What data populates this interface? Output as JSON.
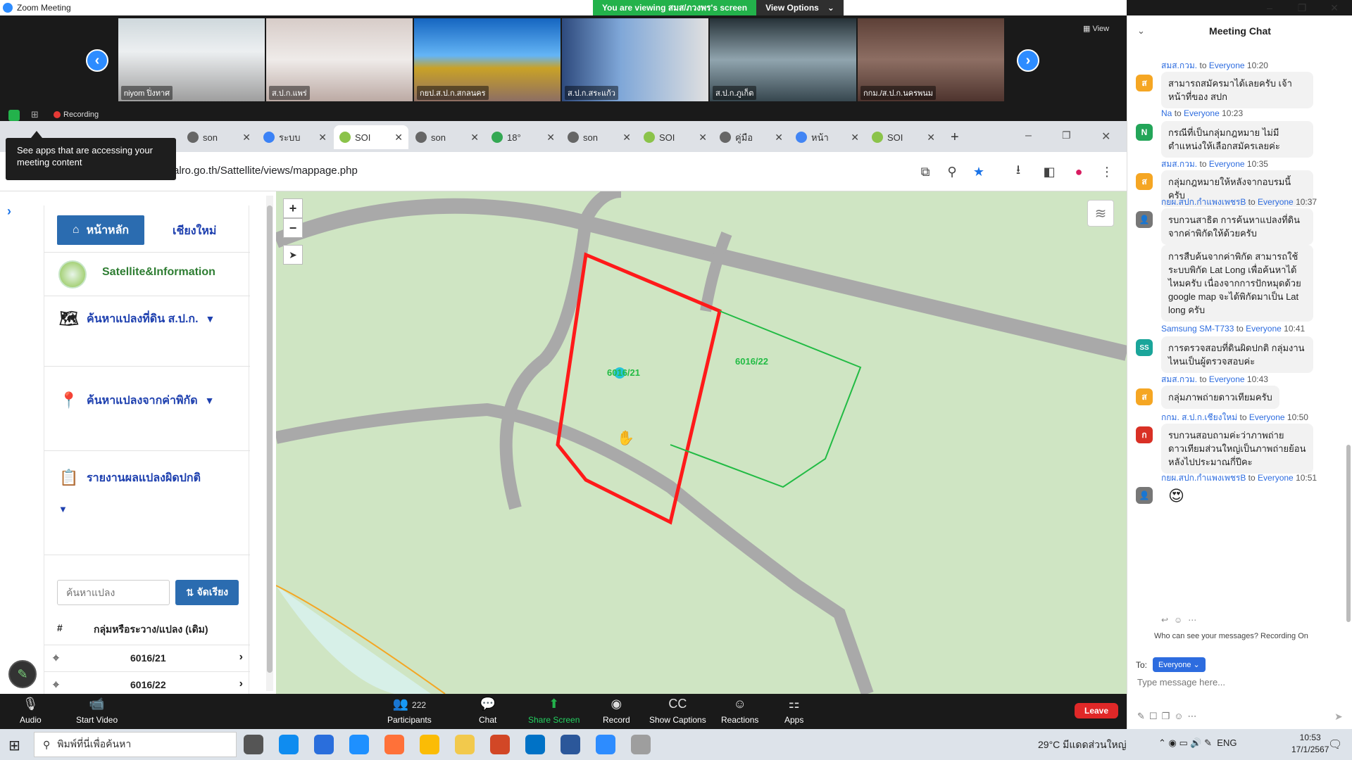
{
  "zoom": {
    "title": "Zoom Meeting",
    "viewing_banner": "You are viewing สมส/ภวงพร's screen",
    "view_options": "View Options",
    "view_label": "View",
    "recording": "Recording",
    "participants": [
      {
        "name": "niyom ปิ่งทาศ"
      },
      {
        "name": "ส.ป.ก.แพร่"
      },
      {
        "name": "กยป.ส.ป.ก.สกลนคร"
      },
      {
        "name": "ส.ป.ก.สระแก้ว"
      },
      {
        "name": "ส.ป.ก.ภูเก็ต"
      },
      {
        "name": "กกม./ส.ป.ก.นครพนม"
      }
    ],
    "toolbar": {
      "audio": "Audio",
      "start_video": "Start Video",
      "participants": "Participants",
      "participant_count": "222",
      "chat": "Chat",
      "share_screen": "Share Screen",
      "record": "Record",
      "show_captions": "Show Captions",
      "reactions": "Reactions",
      "apps": "Apps",
      "leave": "Leave"
    },
    "tooltip": "See apps that are accessing your meeting content"
  },
  "browser": {
    "tabs": [
      {
        "label": "son"
      },
      {
        "label": "SOI"
      },
      {
        "label": "son"
      },
      {
        "label": "ระบบ"
      },
      {
        "label": "SOI"
      },
      {
        "label": "son"
      },
      {
        "label": "18°"
      },
      {
        "label": "son"
      },
      {
        "label": "SOI"
      },
      {
        "label": "คู่มือ"
      },
      {
        "label": "หน้า"
      },
      {
        "label": "SOI"
      }
    ],
    "url": "alro.go.th/Sattellite/views/mappage.php"
  },
  "sidebar": {
    "home": "หน้าหลัก",
    "chiangmai": "เชียงใหม่",
    "brand": "Satellite&Information",
    "menu": [
      {
        "label": "ค้นหาแปลงที่ดิน ส.ป.ก."
      },
      {
        "label": "ค้นหาแปลงจากค่าพิกัด"
      },
      {
        "label": "รายงานผลแปลงผิดปกติ"
      }
    ],
    "search_placeholder": "ค้นหาแปลง",
    "sort_label": "จัดเรียง",
    "table_header": {
      "num": "#",
      "group": "กลุ่มหรือระวาง/แปลง (เดิม)"
    },
    "rows": [
      {
        "value": "6016/21"
      },
      {
        "value": "6016/22"
      }
    ]
  },
  "map": {
    "zoom_in": "+",
    "zoom_out": "−",
    "plot_labels": [
      {
        "text": "6016/21"
      },
      {
        "text": "6016/22"
      }
    ],
    "colors": {
      "red_plot": "#ff1a1a",
      "green_plot": "#22bb44",
      "road": "#a9a9a9",
      "background": "#cfe5c3"
    }
  },
  "chat": {
    "title": "Meeting Chat",
    "messages": [
      {
        "sender": "สมส.กวม.",
        "to": "to",
        "target": "Everyone",
        "time": "10:20",
        "avatar": "ส",
        "avatar_color": "#f5a623",
        "text": "สามารถสมัครมาได้เลยครับ เจ้าหน้าที่ของ สปก"
      },
      {
        "sender": "Na",
        "to": "to",
        "target": "Everyone",
        "time": "10:23",
        "avatar": "N",
        "avatar_color": "#23a559",
        "text": "กรณีที่เป็นกลุ่มกฎหมาย ไม่มีตำแหน่งให้เลือกสมัครเลยค่ะ"
      },
      {
        "sender": "สมส.กวม.",
        "to": "to",
        "target": "Everyone",
        "time": "10:35",
        "avatar": "ส",
        "avatar_color": "#f5a623",
        "text": "กลุ่มกฎหมายให้หลังจากอบรมนี้ครับ"
      },
      {
        "sender": "กยผ.สปก.กำแพงเพชรB",
        "to": "to",
        "target": "Everyone",
        "time": "10:37",
        "avatar": "",
        "avatar_color": "#777",
        "text": "รบกวนสาธิต การค้นหาแปลงที่ดินจากค่าพิกัดให้ด้วยครับ"
      },
      {
        "sender": "",
        "to": "",
        "target": "",
        "time": "",
        "avatar": "",
        "avatar_color": "",
        "text": "การสืบค้นจากค่าพิกัด สามารถใช้ระบบพิกัด Lat Long เพื่อค้นหาได้ไหมครับ เนื่องจากการปักหมุดด้วย google map จะได้พิกัดมาเป็น Lat long ครับ"
      },
      {
        "sender": "Samsung SM-T733",
        "to": "to",
        "target": "Everyone",
        "time": "10:41",
        "avatar": "SS",
        "avatar_color": "#1aa59a",
        "text": "การตรวจสอบที่ดินผิดปกติ กลุ่มงานไหนเป็นผู้ตรวจสอบค่ะ"
      },
      {
        "sender": "สมส.กวม.",
        "to": "to",
        "target": "Everyone",
        "time": "10:43",
        "avatar": "ส",
        "avatar_color": "#f5a623",
        "text": "กลุ่มภาพถ่ายดาวเทียมครับ"
      },
      {
        "sender": "กกม. ส.ป.ก.เชียงใหม่",
        "to": "to",
        "target": "Everyone",
        "time": "10:50",
        "avatar": "ก",
        "avatar_color": "#d93025",
        "text": "รบกวนสอบถามค่ะว่าภาพถ่ายดาวเทียมส่วนใหญ่เป็นภาพถ่ายย้อนหลังไปประมาณกี่ปีคะ"
      },
      {
        "sender": "กยผ.สปก.กำแพงเพชรB",
        "to": "to",
        "target": "Everyone",
        "time": "10:51",
        "avatar": "",
        "avatar_color": "#777",
        "text": "😍"
      }
    ],
    "who_can_see": "Who can see your messages? Recording On",
    "to_label": "To:",
    "to_target": "Everyone",
    "input_placeholder": "Type message here..."
  },
  "taskbar": {
    "search_placeholder": "พิมพ์ที่นี่เพื่อค้นหา",
    "weather": "29°C มีแดดส่วนใหญ่",
    "lang": "ENG",
    "time": "10:53",
    "date": "17/1/2567"
  }
}
